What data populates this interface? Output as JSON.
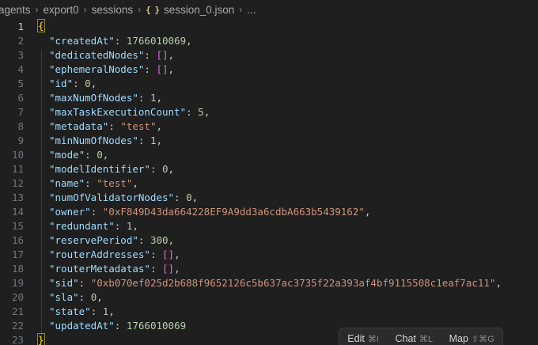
{
  "breadcrumb": {
    "items": [
      "agents",
      "export0",
      "sessions",
      "session_0.json",
      "..."
    ],
    "json_icon": "{ }"
  },
  "toolbar": {
    "edit_label": "Edit",
    "edit_kbd": "⌘I",
    "chat_label": "Chat",
    "chat_kbd": "⌘L",
    "map_label": "Map",
    "map_kbd": "⇧⌘G"
  },
  "editor": {
    "active_line": 1,
    "lines": [
      {
        "n": "1",
        "key": "",
        "value": "",
        "kind": "open"
      },
      {
        "n": "2",
        "key": "\"createdAt\"",
        "value": "1766010069",
        "kind": "num"
      },
      {
        "n": "3",
        "key": "\"dedicatedNodes\"",
        "value": "[]",
        "kind": "arr"
      },
      {
        "n": "4",
        "key": "\"ephemeralNodes\"",
        "value": "[]",
        "kind": "arr"
      },
      {
        "n": "5",
        "key": "\"id\"",
        "value": "0",
        "kind": "num"
      },
      {
        "n": "6",
        "key": "\"maxNumOfNodes\"",
        "value": "1",
        "kind": "num"
      },
      {
        "n": "7",
        "key": "\"maxTaskExecutionCount\"",
        "value": "5",
        "kind": "num"
      },
      {
        "n": "8",
        "key": "\"metadata\"",
        "value": "\"test\"",
        "kind": "str"
      },
      {
        "n": "9",
        "key": "\"minNumOfNodes\"",
        "value": "1",
        "kind": "num"
      },
      {
        "n": "10",
        "key": "\"mode\"",
        "value": "0",
        "kind": "num"
      },
      {
        "n": "11",
        "key": "\"modelIdentifier\"",
        "value": "0",
        "kind": "num"
      },
      {
        "n": "12",
        "key": "\"name\"",
        "value": "\"test\"",
        "kind": "str"
      },
      {
        "n": "13",
        "key": "\"numOfValidatorNodes\"",
        "value": "0",
        "kind": "num"
      },
      {
        "n": "14",
        "key": "\"owner\"",
        "value": "\"0xF849D43da664228EF9A9dd3a6cdbA663b5439162\"",
        "kind": "str"
      },
      {
        "n": "15",
        "key": "\"redundant\"",
        "value": "1",
        "kind": "num"
      },
      {
        "n": "16",
        "key": "\"reservePeriod\"",
        "value": "300",
        "kind": "num"
      },
      {
        "n": "17",
        "key": "\"routerAddresses\"",
        "value": "[]",
        "kind": "arr"
      },
      {
        "n": "18",
        "key": "\"routerMetadatas\"",
        "value": "[]",
        "kind": "arr"
      },
      {
        "n": "19",
        "key": "\"sid\"",
        "value": "\"0xb070ef025d2b688f9652126c5b637ac3735f22a393af4bf9115508c1eaf7ac11\"",
        "kind": "str"
      },
      {
        "n": "20",
        "key": "\"sla\"",
        "value": "0",
        "kind": "num"
      },
      {
        "n": "21",
        "key": "\"state\"",
        "value": "1",
        "kind": "num"
      },
      {
        "n": "22",
        "key": "\"updatedAt\"",
        "value": "1766010069",
        "kind": "num",
        "last": true
      },
      {
        "n": "23",
        "key": "",
        "value": "",
        "kind": "close"
      }
    ]
  }
}
